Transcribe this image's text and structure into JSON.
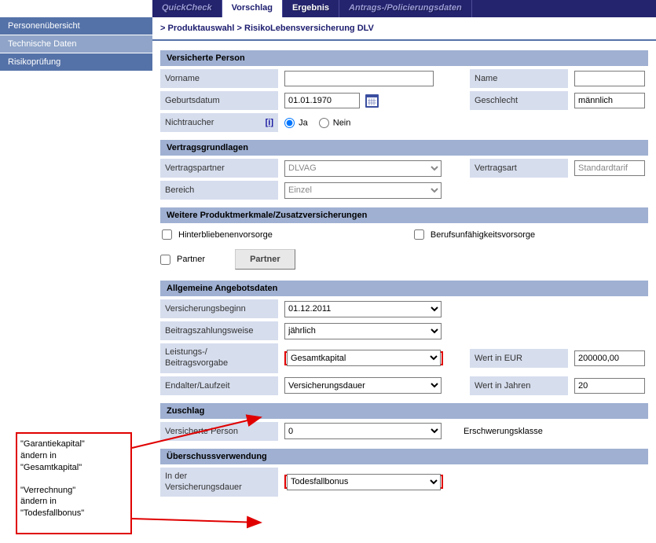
{
  "topnav": {
    "tabs": [
      {
        "label": "QuickCheck"
      },
      {
        "label": "Vorschlag"
      },
      {
        "label": "Ergebnis"
      },
      {
        "label": "Antrags-/Policierungsdaten"
      }
    ]
  },
  "sidebar": {
    "items": [
      {
        "label": "Personenübersicht"
      },
      {
        "label": "Technische Daten"
      },
      {
        "label": "Risikoprüfung"
      }
    ]
  },
  "breadcrumb": {
    "sep": ">",
    "a": "Produktauswahl",
    "b": "RisikoLebensversicherung DLV"
  },
  "sections": {
    "versichertePerson": "Versicherte Person",
    "vertragsgrundlagen": "Vertragsgrundlagen",
    "weitere": "Weitere Produktmerkmale/Zusatzversicherungen",
    "allgemeine": "Allgemeine Angebotsdaten",
    "zuschlag": "Zuschlag",
    "ueberschuss": "Überschussverwendung"
  },
  "labels": {
    "vorname": "Vorname",
    "name": "Name",
    "geburtsdatum": "Geburtsdatum",
    "geschlecht": "Geschlecht",
    "nichtraucher": "Nichtraucher",
    "info": "[i]",
    "ja": "Ja",
    "nein": "Nein",
    "vertragspartner": "Vertragspartner",
    "vertragsart": "Vertragsart",
    "bereich": "Bereich",
    "hinterbliebenen": "Hinterbliebenenvorsorge",
    "berufs": "Berufsunfähigkeitsvorsorge",
    "partner": "Partner",
    "partnerBtn": "Partner",
    "versicherungsbeginn": "Versicherungsbeginn",
    "beitragszahlungsweise": "Beitragszahlungsweise",
    "leistungs": "Leistungs-/",
    "beitrags2": "Beitragsvorgabe",
    "wertInEUR": "Wert in EUR",
    "endalter": "Endalter/Laufzeit",
    "wertInJahren": "Wert in Jahren",
    "versichertePerson2": "Versicherte Person",
    "erschwerungsklasse": "Erschwerungsklasse",
    "inDer": "In der",
    "versicherungsdauer": "Versicherungsdauer"
  },
  "values": {
    "vorname": "",
    "name": "",
    "geburtsdatum": "01.01.1970",
    "geschlecht": "männlich",
    "vertragspartner": "DLVAG",
    "vertragsart": "Standardtarif",
    "bereich": "Einzel",
    "versicherungsbeginn": "01.12.2011",
    "beitragszahlungsweise": "jährlich",
    "leistungsvorgabe": "Gesamtkapital",
    "wertInEUR": "200000,00",
    "endalter": "Versicherungsdauer",
    "wertInJahren": "20",
    "zuschlagPerson": "0",
    "ueberschuss": "Todesfallbonus"
  },
  "annotation": {
    "line1": "\"Garantiekapital\"",
    "line2": "ändern in",
    "line3": "\"Gesamtkapital\"",
    "line4": "\"Verrechnung\"",
    "line5": "ändern in",
    "line6": "\"Todesfallbonus\""
  }
}
